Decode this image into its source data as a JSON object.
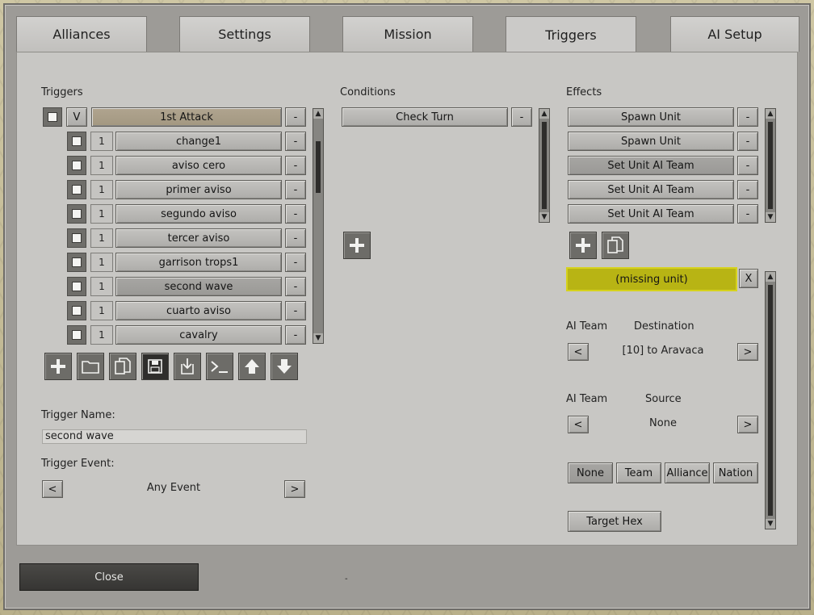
{
  "tabs": [
    "Alliances",
    "Settings",
    "Mission",
    "Triggers",
    "AI Setup"
  ],
  "triggers": {
    "label": "Triggers",
    "header": {
      "toggle": "V",
      "name": "1st Attack",
      "remove": "-"
    },
    "rows": [
      {
        "num": "1",
        "name": "change1",
        "remove": "-"
      },
      {
        "num": "1",
        "name": "aviso cero",
        "remove": "-"
      },
      {
        "num": "1",
        "name": "primer aviso",
        "remove": "-"
      },
      {
        "num": "1",
        "name": "segundo aviso",
        "remove": "-"
      },
      {
        "num": "1",
        "name": "tercer aviso",
        "remove": "-"
      },
      {
        "num": "1",
        "name": "garrison trops1",
        "remove": "-"
      },
      {
        "num": "1",
        "name": "second wave",
        "remove": "-"
      },
      {
        "num": "1",
        "name": "cuarto aviso",
        "remove": "-"
      },
      {
        "num": "1",
        "name": "cavalry",
        "remove": "-"
      }
    ],
    "toolbar_icons": [
      "plus-icon",
      "folder-icon",
      "copy-icon",
      "save-icon",
      "import-icon",
      "console-icon",
      "arrow-up-icon",
      "arrow-down-icon"
    ],
    "name_label": "Trigger Name:",
    "name_value": "second wave",
    "event_label": "Trigger Event:",
    "event_prev": "<",
    "event_value": "Any Event",
    "event_next": ">"
  },
  "conditions": {
    "label": "Conditions",
    "items": [
      {
        "name": "Check Turn",
        "remove": "-"
      }
    ]
  },
  "effects": {
    "label": "Effects",
    "items": [
      {
        "name": "Spawn Unit",
        "remove": "-"
      },
      {
        "name": "Spawn Unit",
        "remove": "-"
      },
      {
        "name": "Set Unit AI Team",
        "remove": "-"
      },
      {
        "name": "Set Unit AI Team",
        "remove": "-"
      },
      {
        "name": "Set Unit AI Team",
        "remove": "-"
      }
    ],
    "missing_unit": "(missing unit)",
    "missing_close": "X",
    "destination": {
      "label1": "AI Team",
      "label2": "Destination",
      "prev": "<",
      "value": "[10] to Aravaca",
      "next": ">"
    },
    "source": {
      "label1": "AI Team",
      "label2": "Source",
      "prev": "<",
      "value": "None",
      "next": ">"
    },
    "filters": [
      "None",
      "Team",
      "Alliance",
      "Nation"
    ],
    "target_hex": "Target Hex"
  },
  "footer": {
    "close": "Close",
    "dot": "-"
  }
}
